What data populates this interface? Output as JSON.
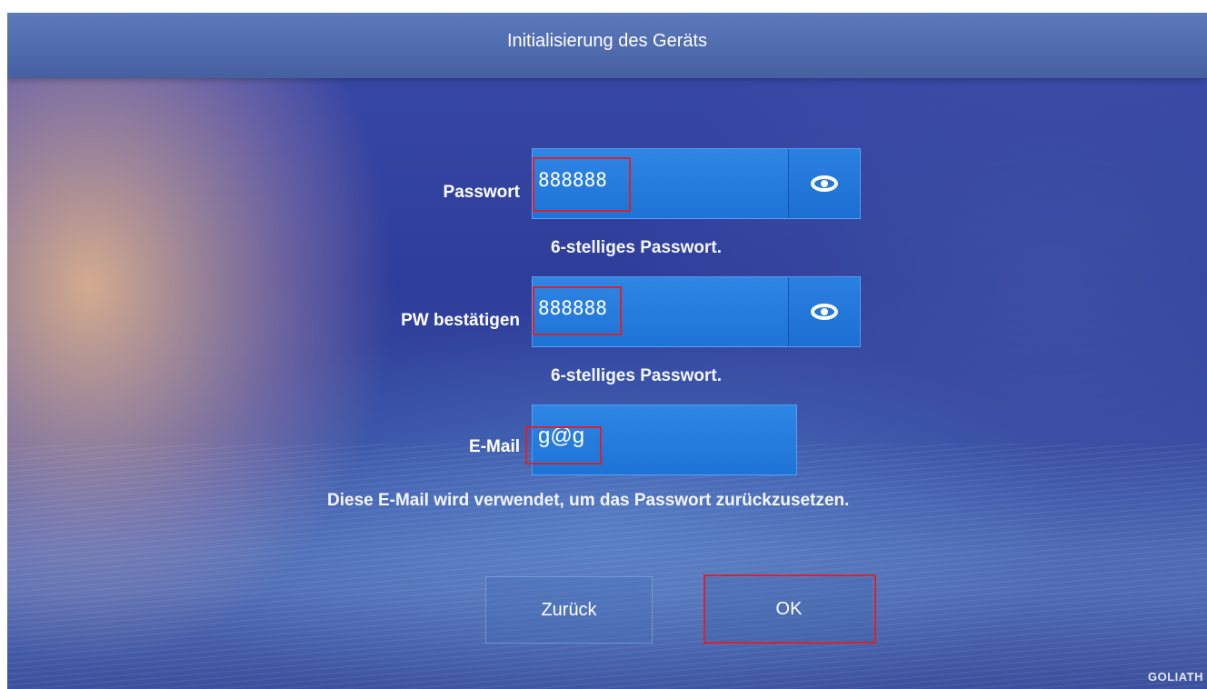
{
  "window": {
    "title": "Initialisierung des Geräts"
  },
  "form": {
    "password": {
      "label": "Passwort",
      "value": "888888",
      "hint": "6-stelliges Passwort.",
      "toggle_icon": "eye-icon"
    },
    "confirm_password": {
      "label": "PW bestätigen",
      "value": "888888",
      "hint": "6-stelliges Passwort.",
      "toggle_icon": "eye-icon"
    },
    "email": {
      "label": "E-Mail",
      "value": "g@g",
      "hint": "Diese E-Mail wird verwendet, um das Passwort zurückzusetzen."
    }
  },
  "buttons": {
    "back_label": "Zurück",
    "ok_label": "OK"
  },
  "brand": {
    "text": "GOLIATH"
  },
  "colors": {
    "field_background": "#1e73d6",
    "highlight_border": "#d9222a",
    "title_bar": "#5c79bc"
  }
}
